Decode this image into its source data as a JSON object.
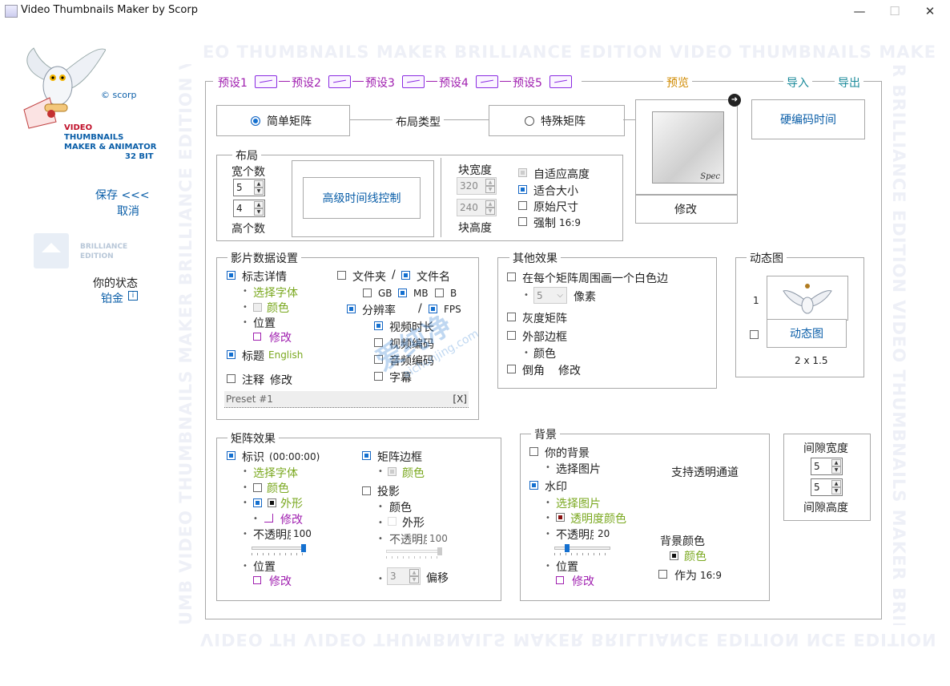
{
  "window": {
    "title": "Video Thumbnails Maker by Scorp",
    "minimize": "—",
    "maximize": "☐",
    "close": "✕"
  },
  "watermark": {
    "top": "EO THUMBNAILS MAKER   BRILLIANCE EDITION   VIDEO THUMBNAILS MAKE",
    "bottom": "UMB   VIDEO THUMBNAILS MAKER   BRILLIANCE EDITION   VIDEO TH",
    "bottom_flipped": "VIDEO TH   VIDEO THUMBNAILS MAKER   BRILLIANCE EDITION   NCE EDITION",
    "left": "UMB   VIDEO THUMBNAILS MAKER   BRILLIANCE EDITION   VID",
    "right": "R   BRILLIANCE EDITION   VIDEO THUMBNAILS MAKER   BRILLIA"
  },
  "sidebar": {
    "copyright": "© scorp",
    "logo_lines": [
      "VIDEO",
      "THUMBNAILS",
      "MAKER & ANIMATOR",
      "32 BIT"
    ],
    "save": "保存 <<<",
    "cancel": "取消",
    "edition_lines": [
      "BRILLIANCE",
      "EDITION"
    ],
    "status_label": "你的状态",
    "status_value": "铂金"
  },
  "top_tabs": {
    "presets": [
      "预设1",
      "预设2",
      "预设3",
      "预设4",
      "预设5"
    ],
    "preview": "预览",
    "import": "导入",
    "export": "导出"
  },
  "layout_type": {
    "simple": "简单矩阵",
    "label": "布局类型",
    "special": "特殊矩阵"
  },
  "preview_box": {
    "thumb_caption": "Spec",
    "modify": "修改"
  },
  "hard_time": "硬编码时间",
  "layout": {
    "title": "布局",
    "cols_label": "宽个数",
    "cols": "5",
    "rows": "4",
    "rows_label": "高个数",
    "timeline_btn": "高级时间线控制",
    "block_width_label": "块宽度",
    "block_width": "320",
    "block_height": "240",
    "block_height_label": "块高度",
    "auto_height": "自适应高度",
    "fit_size": "适合大小",
    "original_size": "原始尺寸",
    "force": "强制",
    "force_ratio": "16:9"
  },
  "movie_data": {
    "title": "影片数据设置",
    "logo_details": "标志详情",
    "select_font": "选择字体",
    "color": "颜色",
    "position": "位置",
    "modify": "修改",
    "title_label": "标题",
    "title_lang": "English",
    "comment": "注释",
    "comment_modify": "修改",
    "folder": "文件夹",
    "slash": "/",
    "filename": "文件名",
    "gb": "GB",
    "mb": "MB",
    "b": "B",
    "resolution": "分辨率",
    "fps": "FPS",
    "duration": "视频时长",
    "video_codec": "视频编码",
    "audio_codec": "音频编码",
    "subtitle": "字幕",
    "preset_value": "Preset #1",
    "preset_clear": "[X]"
  },
  "other_effects": {
    "title": "其他效果",
    "white_border": "在每个矩阵周围画一个白色边",
    "pixels_value": "5",
    "pixels": "像素",
    "gray": "灰度矩阵",
    "outer_border": "外部边框",
    "color": "颜色",
    "rounded": "倒角",
    "modify": "修改"
  },
  "animation": {
    "title": "动态图",
    "index": "1",
    "button": "动态图",
    "size": "2 x 1.5"
  },
  "matrix_effects": {
    "title": "矩阵效果",
    "mark": "标识",
    "mark_time": "(00:00:00)",
    "select_font": "选择字体",
    "color": "颜色",
    "shape": "外形",
    "modify": "修改",
    "opacity": "不透明度",
    "opacity_value": "100",
    "position": "位置",
    "position_modify": "修改",
    "matrix_border": "矩阵边框",
    "border_color": "颜色",
    "shadow": "投影",
    "shadow_color": "颜色",
    "shadow_shape": "外形",
    "shadow_opacity": "不透明度",
    "shadow_opacity_value": "100",
    "offset_value": "3",
    "offset": "偏移",
    "opacity_fraction": 1.0,
    "shadow_opacity_fraction": 1.0
  },
  "background": {
    "title": "背景",
    "your_bg": "你的背景",
    "select_image": "选择图片",
    "alpha_support": "支持透明通道",
    "watermark": "水印",
    "wm_select_image": "选择图片",
    "wm_color": "透明度颜色",
    "opacity": "不透明度",
    "opacity_value": "20",
    "position": "位置",
    "modify": "修改",
    "bg_color_label": "背景颜色",
    "bg_color": "颜色",
    "as_ratio": "作为",
    "ratio": "16:9",
    "opacity_fraction": 0.2
  },
  "gap": {
    "width_label": "间隙宽度",
    "width": "5",
    "height": "5",
    "height_label": "间隙高度"
  },
  "overlay_watermark": {
    "text": "爱纯净",
    "url": "aichunjing.com"
  }
}
